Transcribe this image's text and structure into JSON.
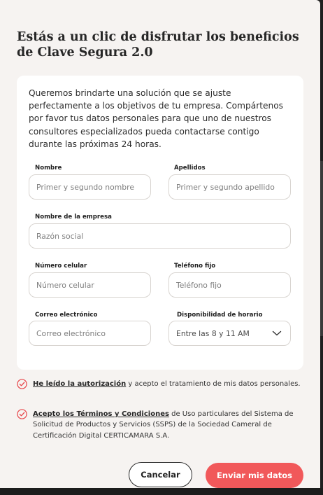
{
  "modal": {
    "title": "Estás a un clic de disfrutar los beneficios de Clave Segura 2.0",
    "intro": "Queremos brindarte una solución que se ajuste perfectamente a los objetivos de tu empresa. Compártenos por favor tus datos personales para que uno de nuestros consultores especializados pueda contactarse contigo durante las próximas 24 horas."
  },
  "form": {
    "nombre": {
      "label": "Nombre",
      "placeholder": "Primer y segundo nombre"
    },
    "apellidos": {
      "label": "Apellidos",
      "placeholder": "Primer y segundo apellido"
    },
    "empresa": {
      "label": "Nombre de la empresa",
      "placeholder": "Razón social"
    },
    "celular": {
      "label": "Número celular",
      "placeholder": "Número celular"
    },
    "fijo": {
      "label": "Teléfono fijo",
      "placeholder": "Teléfono fijo"
    },
    "correo": {
      "label": "Correo electrónico",
      "placeholder": "Correo electrónico"
    },
    "disponibilidad": {
      "label": "Disponibilidad de horario",
      "value": "Entre las 8 y 11 AM"
    }
  },
  "consents": {
    "authorization": {
      "link": "He leído la autorización",
      "text": " y acepto el tratamiento de mis datos personales."
    },
    "terms": {
      "link": "Acepto los Términos y Condiciones",
      "text": " de Uso particulares del Sistema de Solicitud de Productos y Servicios (SSPS) de la Sociedad Cameral de Certificación Digital CERTICAMARA S.A."
    }
  },
  "actions": {
    "cancel_label": "Cancelar",
    "submit_label": "Enviar mis datos"
  },
  "icons": {
    "check": "check-circle-icon",
    "select": "chevron-down-icon"
  },
  "colors": {
    "accent": "#f1585a",
    "modal_bg": "#f6f3f1",
    "card_bg": "#ffffff"
  }
}
